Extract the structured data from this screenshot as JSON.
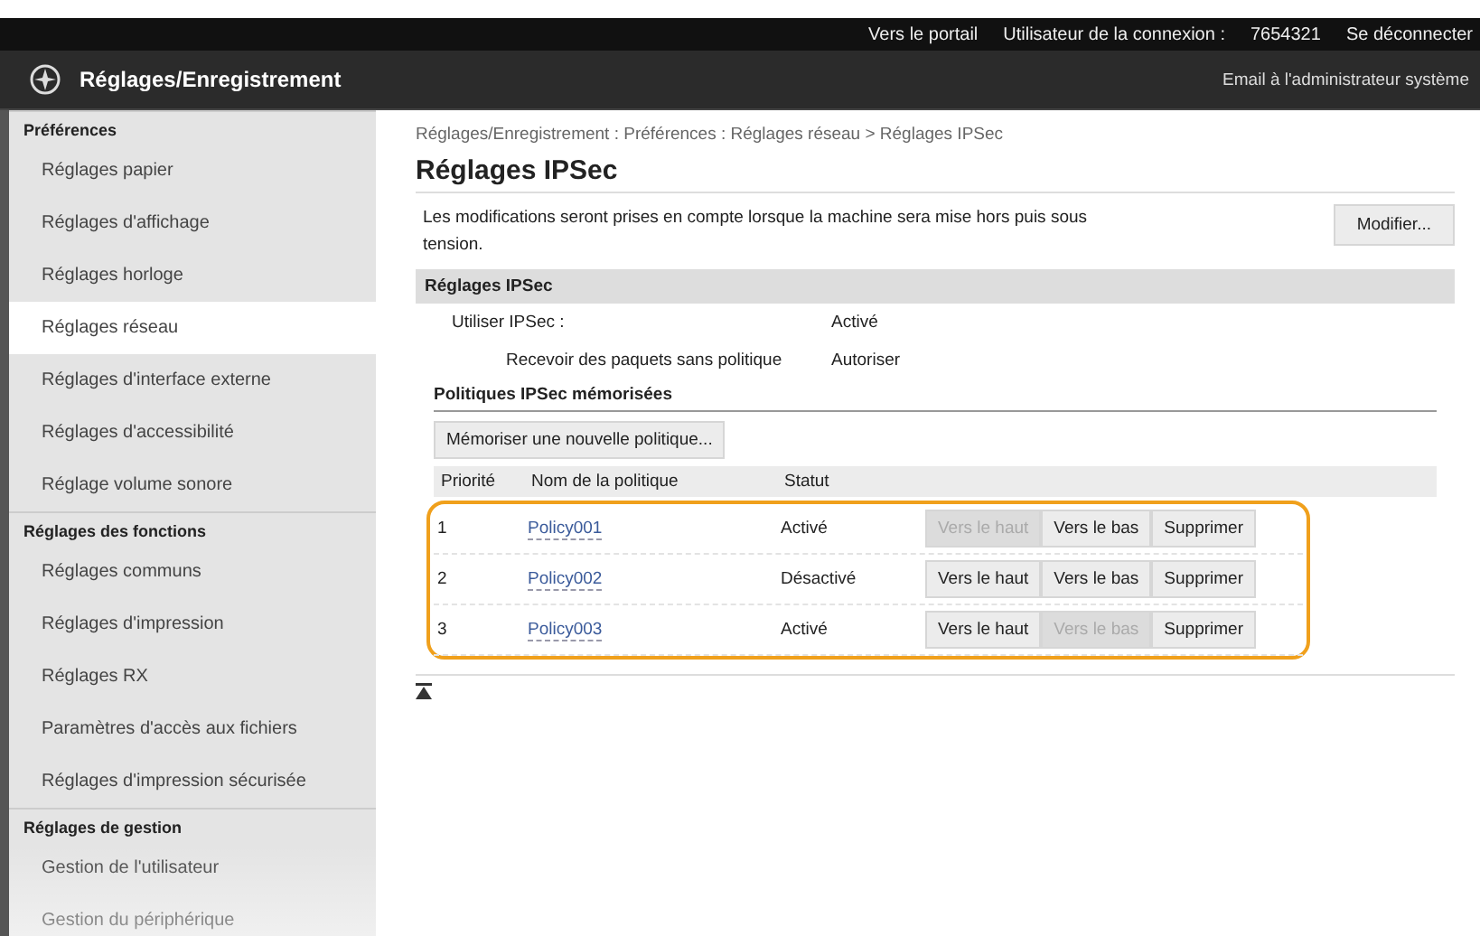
{
  "top_bar": {
    "links": [
      "Vers le portail"
    ],
    "user_label": "Utilisateur de la connexion :",
    "user_id": "7654321",
    "logout": "Se déconnecter"
  },
  "header": {
    "title": "Réglages/Enregistrement",
    "email_link": "Email à l'administrateur système"
  },
  "sidebar": {
    "sections": [
      {
        "title": "Préférences",
        "items": [
          {
            "label": "Réglages papier",
            "selected": false
          },
          {
            "label": "Réglages d'affichage",
            "selected": false
          },
          {
            "label": "Réglages horloge",
            "selected": false
          },
          {
            "label": "Réglages réseau",
            "selected": true
          },
          {
            "label": "Réglages d'interface externe",
            "selected": false
          },
          {
            "label": "Réglages d'accessibilité",
            "selected": false
          },
          {
            "label": "Réglage volume sonore",
            "selected": false
          }
        ]
      },
      {
        "title": "Réglages des fonctions",
        "items": [
          {
            "label": "Réglages communs",
            "selected": false
          },
          {
            "label": "Réglages d'impression",
            "selected": false
          },
          {
            "label": "Réglages RX",
            "selected": false
          },
          {
            "label": "Paramètres d'accès aux fichiers",
            "selected": false
          },
          {
            "label": "Réglages d'impression sécurisée",
            "selected": false
          }
        ]
      },
      {
        "title": "Réglages de gestion",
        "items": [
          {
            "label": "Gestion de l'utilisateur",
            "selected": false
          },
          {
            "label": "Gestion du périphérique",
            "selected": false
          }
        ]
      }
    ]
  },
  "breadcrumb": "Réglages/Enregistrement : Préférences : Réglages réseau > Réglages IPSec",
  "page_title": "Réglages IPSec",
  "notice": "Les modifications seront prises en compte lorsque la machine sera mise hors puis sous tension.",
  "edit_button": "Modifier...",
  "section_title": "Réglages IPSec",
  "settings": [
    {
      "label": "Utiliser IPSec :",
      "value": "Activé",
      "indented": false
    },
    {
      "label": "Recevoir des paquets sans politique",
      "value": "Autoriser",
      "indented": true
    }
  ],
  "policies": {
    "title": "Politiques IPSec mémorisées",
    "add_button": "Mémoriser une nouvelle politique...",
    "columns": [
      "Priorité",
      "Nom de la politique",
      "Statut"
    ],
    "rows": [
      {
        "priority": "1",
        "name": "Policy001",
        "status": "Activé",
        "buttons": [
          {
            "label": "Vers le haut",
            "disabled": true
          },
          {
            "label": "Vers le bas",
            "disabled": false
          },
          {
            "label": "Supprimer",
            "disabled": false
          }
        ]
      },
      {
        "priority": "2",
        "name": "Policy002",
        "status": "Désactivé",
        "buttons": [
          {
            "label": "Vers le haut",
            "disabled": false
          },
          {
            "label": "Vers le bas",
            "disabled": false
          },
          {
            "label": "Supprimer",
            "disabled": false
          }
        ]
      },
      {
        "priority": "3",
        "name": "Policy003",
        "status": "Activé",
        "buttons": [
          {
            "label": "Vers le haut",
            "disabled": false
          },
          {
            "label": "Vers le bas",
            "disabled": true
          },
          {
            "label": "Supprimer",
            "disabled": false
          }
        ]
      }
    ],
    "highlighted": true
  }
}
